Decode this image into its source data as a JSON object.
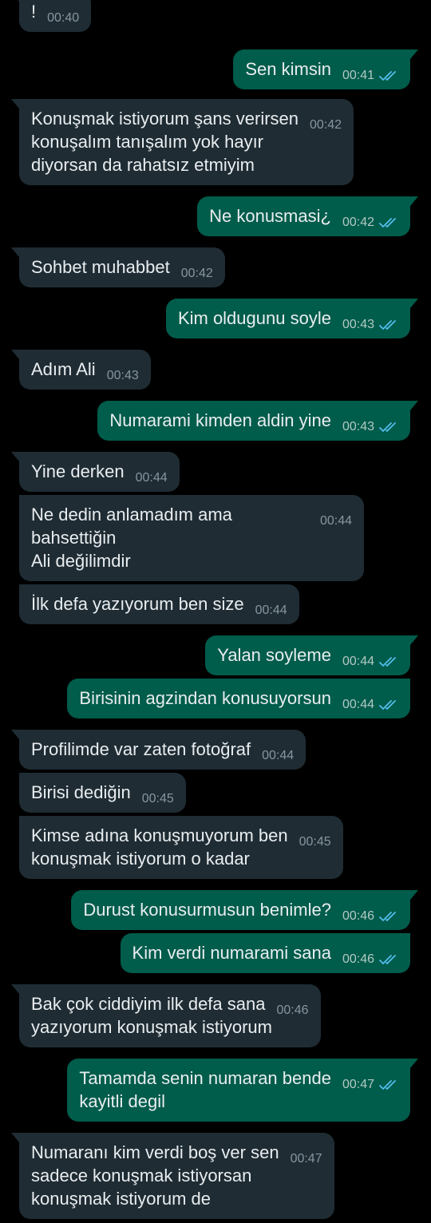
{
  "theme": {
    "background": "#000000",
    "incoming_bubble": "#1f2c34",
    "outgoing_bubble": "#005c4b",
    "text": "#e9edef",
    "read_tick": "#53bdeb"
  },
  "messages": [
    {
      "dir": "in",
      "text": "!",
      "time": "00:40",
      "first": true,
      "gap": 0
    },
    {
      "dir": "out",
      "text": "Sen kimsin",
      "time": "00:41",
      "read": true,
      "first": true,
      "gap": 22
    },
    {
      "dir": "in",
      "text": "Konuşmak istiyorum şans verirsen\nkonuşalım tanışalım yok hayır\ndiyorsan da rahatsız etmiyim",
      "time": "00:42",
      "first": true,
      "gap": 12
    },
    {
      "dir": "out",
      "text": "Ne konusmasi¿",
      "time": "00:42",
      "read": true,
      "first": true,
      "gap": 14
    },
    {
      "dir": "in",
      "text": "Sohbet muhabbet",
      "time": "00:42",
      "first": true,
      "gap": 14
    },
    {
      "dir": "out",
      "text": "Kim oldugunu soyle",
      "time": "00:43",
      "read": true,
      "first": true,
      "gap": 14
    },
    {
      "dir": "in",
      "text": "Adım Ali",
      "time": "00:43",
      "first": true,
      "gap": 14
    },
    {
      "dir": "out",
      "text": "Numarami kimden aldin yine",
      "time": "00:43",
      "read": true,
      "first": true,
      "gap": 14
    },
    {
      "dir": "in",
      "text": "Yine derken",
      "time": "00:44",
      "first": true,
      "gap": 14
    },
    {
      "dir": "in",
      "text": "Ne dedin anlamadım ama bahsettiğin\nAli değilimdir",
      "time": "00:44",
      "first": false,
      "gap": 4
    },
    {
      "dir": "in",
      "text": "İlk defa yazıyorum ben size",
      "time": "00:44",
      "first": false,
      "gap": 4
    },
    {
      "dir": "out",
      "text": "Yalan soyleme",
      "time": "00:44",
      "read": true,
      "first": true,
      "gap": 14
    },
    {
      "dir": "out",
      "text": "Birisinin agzindan konusuyorsun",
      "time": "00:44",
      "read": true,
      "first": false,
      "gap": 4
    },
    {
      "dir": "in",
      "text": "Profilimde var zaten fotoğraf",
      "time": "00:44",
      "first": true,
      "gap": 14
    },
    {
      "dir": "in",
      "text": "Birisi dediğin",
      "time": "00:45",
      "first": false,
      "gap": 4
    },
    {
      "dir": "in",
      "text": "Kimse adına konuşmuyorum ben\nkonuşmak istiyorum o kadar",
      "time": "00:45",
      "first": false,
      "gap": 4
    },
    {
      "dir": "out",
      "text": "Durust konusurmusun benimle?",
      "time": "00:46",
      "read": true,
      "first": true,
      "gap": 14
    },
    {
      "dir": "out",
      "text": "Kim verdi numarami sana",
      "time": "00:46",
      "read": true,
      "first": false,
      "gap": 4
    },
    {
      "dir": "in",
      "text": "Bak çok ciddiyim ilk defa sana\nyazıyorum konuşmak istiyorum",
      "time": "00:46",
      "first": true,
      "gap": 14
    },
    {
      "dir": "out",
      "text": "Tamamda senin numaran bende\nkayitli degil",
      "time": "00:47",
      "read": true,
      "first": true,
      "gap": 14
    },
    {
      "dir": "in",
      "text": "Numaranı kim verdi boş ver sen\nsadece konuşmak istiyorsan\nkonuşmak istiyorum de",
      "time": "00:47",
      "first": true,
      "gap": 14
    }
  ]
}
